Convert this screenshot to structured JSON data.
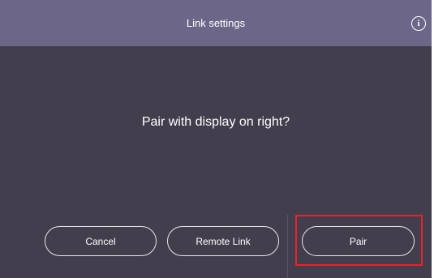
{
  "dialog": {
    "title": "Link settings",
    "info_icon": "info-icon",
    "message": "Pair with display on right?"
  },
  "buttons": {
    "cancel": "Cancel",
    "remote_link": "Remote Link",
    "pair": "Pair"
  },
  "colors": {
    "titlebar": "#6c6789",
    "body": "#433e4d",
    "highlight": "#e8232b"
  }
}
